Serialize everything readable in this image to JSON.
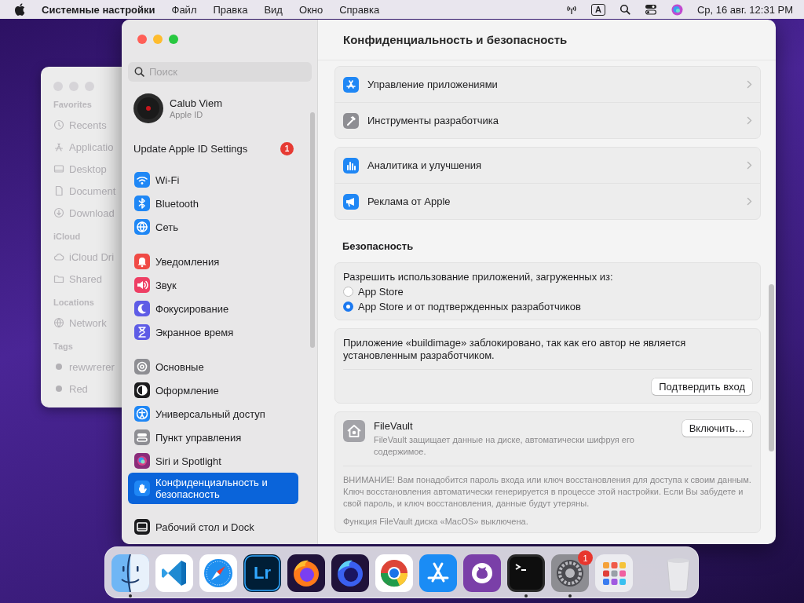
{
  "menu_bar": {
    "app_name": "Системные настройки",
    "menus": [
      "Файл",
      "Правка",
      "Вид",
      "Окно",
      "Справка"
    ],
    "input_source": "A",
    "clock": "Ср, 16 авг. 12:31 PM"
  },
  "finder_window": {
    "sections": [
      {
        "title": "Favorites",
        "items": [
          {
            "label": "Recents",
            "kind": "clock"
          },
          {
            "label": "Applicatio",
            "kind": "apps"
          },
          {
            "label": "Desktop",
            "kind": "desktop"
          },
          {
            "label": "Document",
            "kind": "document"
          },
          {
            "label": "Download",
            "kind": "download"
          }
        ]
      },
      {
        "title": "iCloud",
        "items": [
          {
            "label": "iCloud Dri",
            "kind": "cloud"
          },
          {
            "label": "Shared",
            "kind": "shared"
          }
        ]
      },
      {
        "title": "Locations",
        "items": [
          {
            "label": "Network",
            "kind": "network"
          }
        ]
      },
      {
        "title": "Tags",
        "items": [
          {
            "label": "rewwrerer",
            "kind": "tag"
          },
          {
            "label": "Red",
            "kind": "tag"
          }
        ]
      }
    ]
  },
  "settings_window": {
    "search": {
      "placeholder": "Поиск"
    },
    "account": {
      "name": "Calub Viem",
      "subtitle": "Apple ID"
    },
    "notice": {
      "label": "Update Apple ID Settings",
      "badge": "1"
    },
    "sidebar_groups": [
      {
        "items": [
          {
            "label": "Wi-Fi",
            "kind": "wifi",
            "selected": false
          },
          {
            "label": "Bluetooth",
            "kind": "bluetooth",
            "selected": false
          },
          {
            "label": "Сеть",
            "kind": "globe",
            "selected": false
          }
        ]
      },
      {
        "items": [
          {
            "label": "Уведомления",
            "kind": "bell",
            "selected": false
          },
          {
            "label": "Звук",
            "kind": "speaker",
            "selected": false
          },
          {
            "label": "Фокусирование",
            "kind": "moon",
            "selected": false
          },
          {
            "label": "Экранное время",
            "kind": "hourglass",
            "selected": false
          }
        ]
      },
      {
        "items": [
          {
            "label": "Основные",
            "kind": "gear",
            "selected": false
          },
          {
            "label": "Оформление",
            "kind": "appearance",
            "selected": false
          },
          {
            "label": "Универсальный доступ",
            "kind": "accessibility",
            "selected": false
          },
          {
            "label": "Пункт управления",
            "kind": "toggles",
            "selected": false
          },
          {
            "label": "Siri и Spotlight",
            "kind": "siri",
            "selected": false
          },
          {
            "label": "Конфиденциальность и безопасность",
            "kind": "hand",
            "selected": true
          }
        ]
      },
      {
        "items": [
          {
            "label": "Рабочий стол и Dock",
            "kind": "dock",
            "selected": false
          }
        ]
      }
    ],
    "page_title": "Конфиденциальность и безопасность",
    "sections": [
      {
        "kind": "rows",
        "rows": [
          {
            "label": "Управление приложениями",
            "kind": "appstore"
          },
          {
            "label": "Инструменты разработчика",
            "kind": "hammer"
          }
        ]
      },
      {
        "kind": "rows",
        "rows": [
          {
            "label": "Аналитика и улучшения",
            "kind": "chart"
          },
          {
            "label": "Реклама от Apple",
            "kind": "megaphone"
          }
        ]
      },
      {
        "kind": "heading",
        "text": "Безопасность"
      },
      {
        "kind": "radio",
        "prompt": "Разрешить использование приложений, загруженных из:",
        "options": [
          {
            "label": "App Store",
            "selected": false
          },
          {
            "label": "App Store и от подтвержденных разработчиков",
            "selected": true
          }
        ]
      },
      {
        "kind": "message",
        "text": "Приложение «buildimage» заблокировано, так как его автор не является установленным разработчиком.",
        "button": "Подтвердить вход"
      },
      {
        "kind": "feature",
        "title": "FileVault",
        "description": "FileVault защищает данные на диске, автоматически шифруя его содержимое.",
        "button": "Включить…",
        "warning": "ВНИМАНИЕ! Вам понадобится пароль входа или ключ восстановления для доступа к своим данным. Ключ восстановления автоматически генерируется в процессе этой настройки. Если Вы забудете и свой пароль, и ключ восстановления, данные будут утеряны.",
        "status": "Функция FileVault диска «MacOS» выключена."
      }
    ]
  },
  "dock": {
    "items": [
      {
        "kind": "finder",
        "running": true
      },
      {
        "kind": "code",
        "running": false
      },
      {
        "kind": "compass",
        "running": false
      },
      {
        "kind": "lettered",
        "text": "Lr",
        "running": false
      },
      {
        "kind": "fox",
        "running": false
      },
      {
        "kind": "fox-dark",
        "running": false
      },
      {
        "kind": "ring",
        "running": false
      },
      {
        "kind": "appstore",
        "running": false
      },
      {
        "kind": "cat",
        "running": false
      },
      {
        "kind": "terminal",
        "running": true
      },
      {
        "kind": "gear",
        "running": true,
        "badge": "1"
      },
      {
        "kind": "grid",
        "running": false
      },
      {
        "kind": "trash",
        "running": false
      }
    ]
  }
}
